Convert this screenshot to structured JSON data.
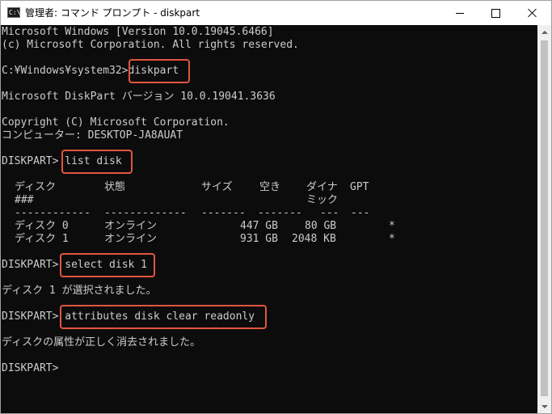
{
  "window": {
    "title": "管理者: コマンド プロンプト - diskpart",
    "icon_text": "C:\\.",
    "icon": "cmd-icon"
  },
  "console": {
    "lines": [
      "Microsoft Windows [Version 10.0.19045.6466]",
      "(c) Microsoft Corporation. All rights reserved.",
      "",
      "C:¥Windows¥system32>diskpart",
      "",
      "Microsoft DiskPart バージョン 10.0.19041.3636",
      "",
      "Copyright (C) Microsoft Corporation.",
      "コンピューター: DESKTOP-JA8AUAT",
      "",
      "DISKPART> list disk",
      "",
      "",
      "",
      "",
      "",
      "",
      "",
      "DISKPART> select disk 1",
      "",
      "ディスク 1 が選択されました。",
      "",
      "DISKPART> attributes disk clear readonly",
      "",
      "ディスクの属性が正しく消去されました。",
      "",
      "DISKPART>"
    ],
    "disk_table": {
      "headers": [
        "ディスク",
        "状態",
        "サイズ",
        "空き",
        "ダイナ",
        "GPT"
      ],
      "header_second_line": [
        "###",
        "",
        "",
        "",
        "ミック",
        ""
      ],
      "separators": [
        "------------",
        "-------------",
        "-------",
        "-------",
        "---",
        "---"
      ],
      "rows": [
        [
          "ディスク 0",
          "オンライン",
          "447 GB",
          "80 GB",
          "",
          "*"
        ],
        [
          "ディスク 1",
          "オンライン",
          "931 GB",
          "2048 KB",
          "",
          "*"
        ]
      ]
    }
  },
  "highlight_color": "#e2563e"
}
